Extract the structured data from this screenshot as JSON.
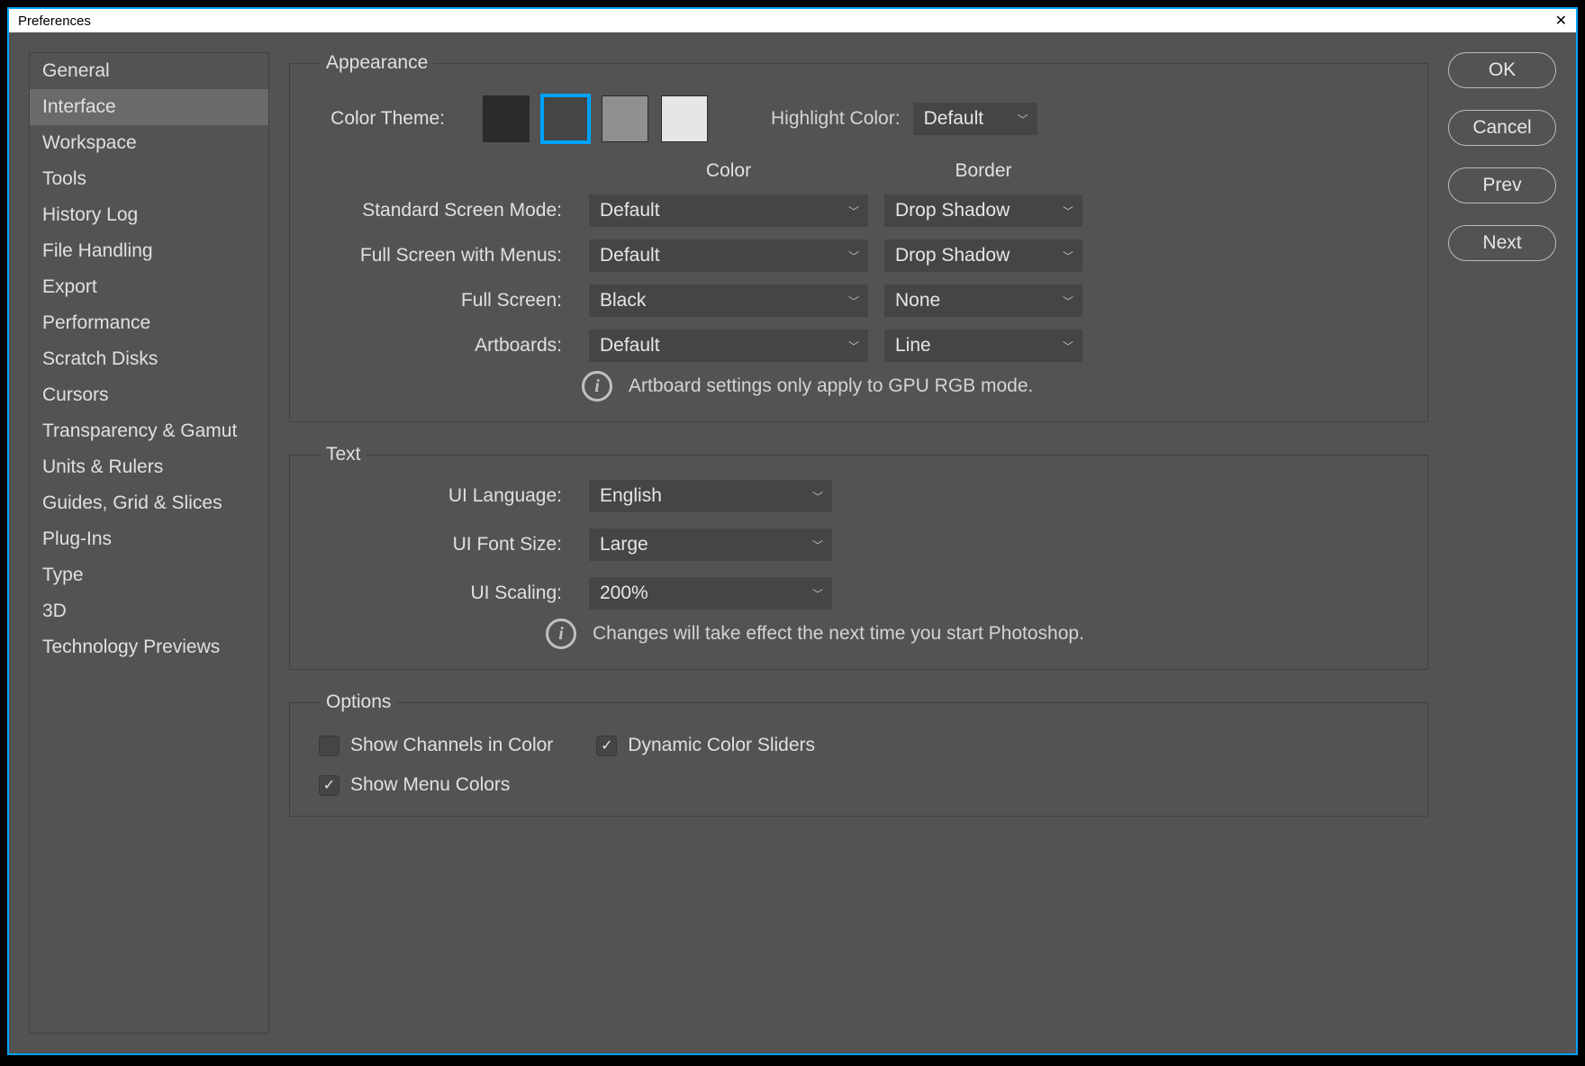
{
  "window": {
    "title": "Preferences"
  },
  "sidebar": {
    "items": [
      "General",
      "Interface",
      "Workspace",
      "Tools",
      "History Log",
      "File Handling",
      "Export",
      "Performance",
      "Scratch Disks",
      "Cursors",
      "Transparency & Gamut",
      "Units & Rulers",
      "Guides, Grid & Slices",
      "Plug-Ins",
      "Type",
      "3D",
      "Technology Previews"
    ],
    "active_index": 1
  },
  "appearance": {
    "legend": "Appearance",
    "color_theme_label": "Color Theme:",
    "swatches": [
      "#2b2b2b",
      "#454545",
      "#909090",
      "#e6e6e6"
    ],
    "selected_swatch": 1,
    "highlight_label": "Highlight Color:",
    "highlight_value": "Default",
    "headers": {
      "color": "Color",
      "border": "Border"
    },
    "modes": [
      {
        "label": "Standard Screen Mode:",
        "color": "Default",
        "border": "Drop Shadow"
      },
      {
        "label": "Full Screen with Menus:",
        "color": "Default",
        "border": "Drop Shadow"
      },
      {
        "label": "Full Screen:",
        "color": "Black",
        "border": "None"
      },
      {
        "label": "Artboards:",
        "color": "Default",
        "border": "Line"
      }
    ],
    "info": "Artboard settings only apply to GPU RGB mode."
  },
  "text": {
    "legend": "Text",
    "rows": [
      {
        "label": "UI Language:",
        "value": "English"
      },
      {
        "label": "UI Font Size:",
        "value": "Large"
      },
      {
        "label": "UI Scaling:",
        "value": "200%"
      }
    ],
    "info": "Changes will take effect the next time you start Photoshop."
  },
  "options": {
    "legend": "Options",
    "checks": [
      {
        "label": "Show Channels in Color",
        "checked": false
      },
      {
        "label": "Dynamic Color Sliders",
        "checked": true
      },
      {
        "label": "Show Menu Colors",
        "checked": true
      }
    ]
  },
  "actions": {
    "ok": "OK",
    "cancel": "Cancel",
    "prev": "Prev",
    "next": "Next"
  }
}
